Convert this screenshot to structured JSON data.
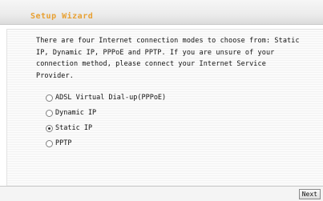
{
  "header": {
    "title": "Setup Wizard"
  },
  "main": {
    "description": "There are four Internet connection modes to choose from: Static IP, Dynamic IP, PPPoE and PPTP. If you are unsure of your connection method, please connect your Internet Service Provider.",
    "options": [
      {
        "label": "ADSL Virtual Dial-up(PPPoE)",
        "checked": false
      },
      {
        "label": "Dynamic IP",
        "checked": false
      },
      {
        "label": "Static IP",
        "checked": true
      },
      {
        "label": "PPTP",
        "checked": false
      }
    ]
  },
  "footer": {
    "next_label": "Next"
  },
  "colors": {
    "title": "#e8a032"
  }
}
